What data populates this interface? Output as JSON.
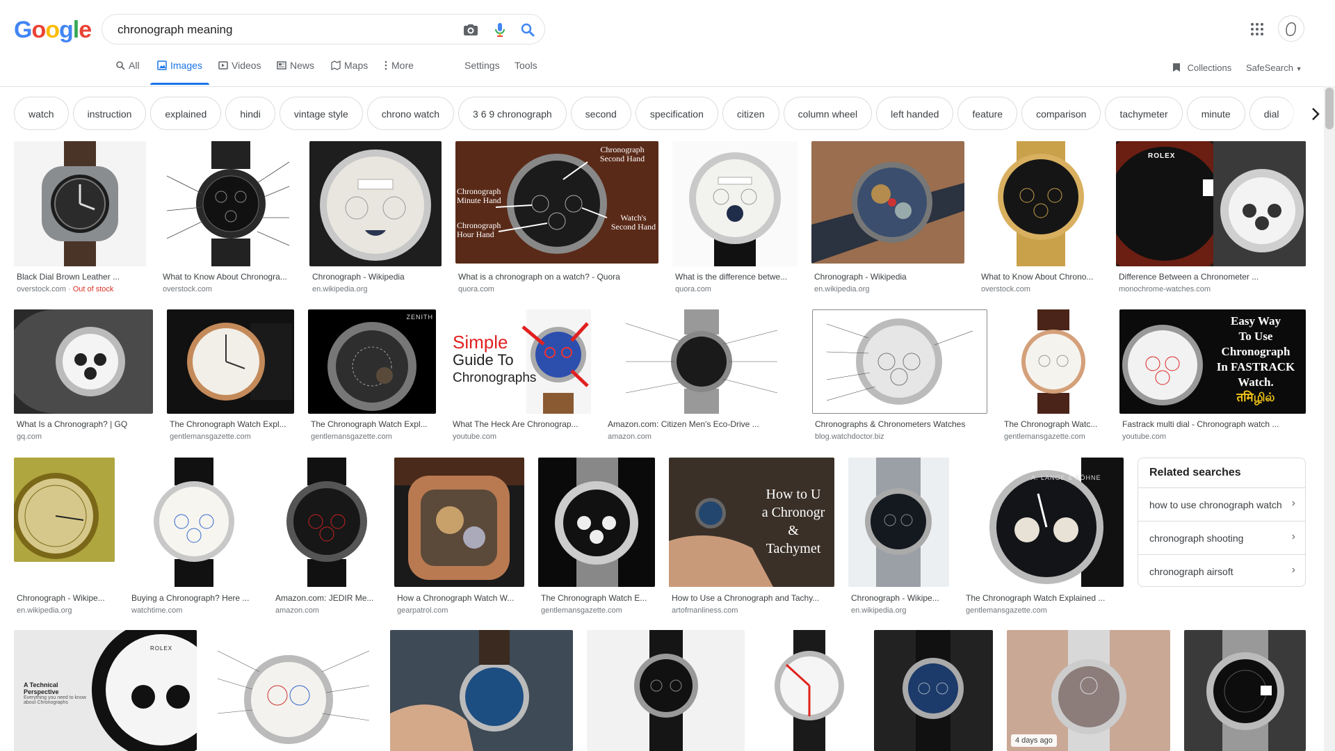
{
  "header": {
    "logo_letters": [
      "G",
      "o",
      "o",
      "g",
      "l",
      "e"
    ],
    "logo_colors": [
      "#4285f4",
      "#ea4335",
      "#fbbc05",
      "#4285f4",
      "#34a853",
      "#ea4335"
    ],
    "search_value": "chronograph meaning",
    "icons": {
      "camera": "camera-icon",
      "mic": "microphone-icon",
      "search": "search-icon",
      "apps": "apps-grid-icon",
      "account": "avatar"
    }
  },
  "nav": {
    "all": "All",
    "images": "Images",
    "videos": "Videos",
    "news": "News",
    "maps": "Maps",
    "more": "More",
    "settings": "Settings",
    "tools": "Tools",
    "collections": "Collections",
    "safesearch": "SafeSearch"
  },
  "accent_color": "#1a73e8",
  "chips": [
    "watch",
    "instruction",
    "explained",
    "hindi",
    "vintage style",
    "chrono watch",
    "3 6 9 chronograph",
    "second",
    "specification",
    "citizen",
    "column wheel",
    "left handed",
    "feature",
    "comparison",
    "tachymeter",
    "minute",
    "dial"
  ],
  "results": [
    {
      "caption": "Black Dial Brown Leather ...",
      "source": "overstock.com",
      "extra": "Out of stock"
    },
    {
      "caption": "What to Know About Chronogra...",
      "source": "overstock.com"
    },
    {
      "caption": "Chronograph - Wikipedia",
      "source": "en.wikipedia.org"
    },
    {
      "caption": "What is a chronograph on a watch? - Quora",
      "source": "quora.com"
    },
    {
      "caption": "What is the difference betwe...",
      "source": "quora.com"
    },
    {
      "caption": "Chronograph - Wikipedia",
      "source": "en.wikipedia.org"
    },
    {
      "caption": "What to Know About Chrono...",
      "source": "overstock.com"
    },
    {
      "caption": "Difference Between a Chronometer ...",
      "source": "monochrome-watches.com"
    },
    {
      "caption": "What Is a Chronograph? | GQ",
      "source": "gq.com"
    },
    {
      "caption": "The Chronograph Watch Expl...",
      "source": "gentlemansgazette.com"
    },
    {
      "caption": "The Chronograph Watch Expl...",
      "source": "gentlemansgazette.com"
    },
    {
      "caption": "What The Heck Are Chronograp...",
      "source": "youtube.com"
    },
    {
      "caption": "Amazon.com: Citizen Men's Eco-Drive ...",
      "source": "amazon.com"
    },
    {
      "caption": "Chronographs & Chronometers Watches",
      "source": "blog.watchdoctor.biz"
    },
    {
      "caption": "The Chronograph Watc...",
      "source": "gentlemansgazette.com"
    },
    {
      "caption": "Fastrack multi dial - Chronograph watch ...",
      "source": "youtube.com"
    },
    {
      "caption": "Chronograph - Wikipe...",
      "source": "en.wikipedia.org"
    },
    {
      "caption": "Buying a Chronograph? Here ...",
      "source": "watchtime.com"
    },
    {
      "caption": "Amazon.com: JEDIR Me...",
      "source": "amazon.com"
    },
    {
      "caption": "How a Chronograph Watch W...",
      "source": "gearpatrol.com"
    },
    {
      "caption": "The Chronograph Watch E...",
      "source": "gentlemansgazette.com"
    },
    {
      "caption": "How to Use a Chronograph and Tachy...",
      "source": "artofmanliness.com"
    },
    {
      "caption": "Chronograph - Wikipe...",
      "source": "en.wikipedia.org"
    },
    {
      "caption": "The Chronograph Watch Explained ...",
      "source": "gentlemansgazette.com"
    }
  ],
  "image_text": {
    "r4_top": "Chronograph Second Hand",
    "r4_left1": "Chronograph Minute Hand",
    "r4_left2": "Chronograph Hour Hand",
    "r4_right": "Watch's Second Hand",
    "r12": [
      "Simple",
      "Guide To",
      "Chronographs"
    ],
    "r16": [
      "Easy Way",
      "To Use",
      "Chronograph",
      "In FASTRACK",
      "Watch.",
      "तमिழில்"
    ],
    "r22": [
      "How to U",
      "a Chronogr",
      "&",
      "Tachymet"
    ],
    "r8_brand": "ROLEX",
    "r11_brand": "ZENITH",
    "r24_brand": "A. LANGE & SÖHNE",
    "r25_title": "A Technical Perspective",
    "r25_sub": "Everything you need to know about Chronographs",
    "r25_brand": "ROLEX"
  },
  "related": {
    "title": "Related searches",
    "items": [
      "how to use chronograph watch",
      "chronograph shooting",
      "chronograph airsoft"
    ]
  },
  "bottom_badge": "4 days ago"
}
